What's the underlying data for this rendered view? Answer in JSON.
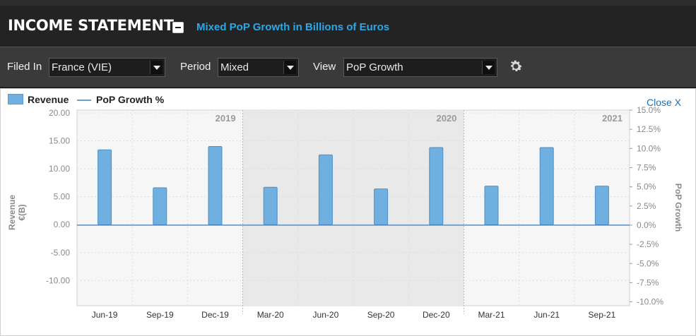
{
  "header": {
    "title": "INCOME STATEMENT",
    "subtitle": "Mixed PoP Growth in Billions of Euros"
  },
  "toolbar": {
    "filed_in_label": "Filed In",
    "filed_in_value": "France (VIE)",
    "period_label": "Period",
    "period_value": "Mixed",
    "view_label": "View",
    "view_value": "PoP Growth"
  },
  "chart_panel": {
    "close_label": "Close X"
  },
  "chart_data": {
    "type": "bar",
    "categories": [
      "Jun-19",
      "Sep-19",
      "Dec-19",
      "Mar-20",
      "Jun-20",
      "Sep-20",
      "Dec-20",
      "Mar-21",
      "Jun-21",
      "Sep-21"
    ],
    "series": [
      {
        "name": "Revenue",
        "type": "bar",
        "values": [
          13.4,
          6.6,
          14.0,
          6.7,
          12.5,
          6.4,
          13.8,
          6.9,
          13.8,
          6.9
        ]
      },
      {
        "name": "PoP Growth %",
        "type": "line",
        "values": [
          0,
          0,
          0,
          0,
          0,
          0,
          0,
          0,
          0,
          0
        ]
      }
    ],
    "year_labels": [
      "2019",
      "2020",
      "2021"
    ],
    "left_axis": {
      "label": "Revenue €(B)",
      "ticks": [
        "20.00",
        "15.00",
        "10.00",
        "5.00",
        "0.00",
        "-5.00",
        "-10.00"
      ],
      "ylim": [
        -14.5,
        20.5
      ]
    },
    "right_axis": {
      "label": "PoP Growth",
      "ticks": [
        "15.0%",
        "12.5%",
        "10.0%",
        "7.5%",
        "5.0%",
        "2.5%",
        "0.0%",
        "-2.5%",
        "-5.0%",
        "-7.5%",
        "-10.0%"
      ],
      "ylim": [
        -10.5,
        15.0
      ]
    },
    "colors": {
      "bar": "#6fb0e0",
      "bar_edge": "#4f8fc4",
      "line": "#4a86c0",
      "shade": "#e9e9e9"
    },
    "grid": true,
    "legend_position": "top-left"
  }
}
